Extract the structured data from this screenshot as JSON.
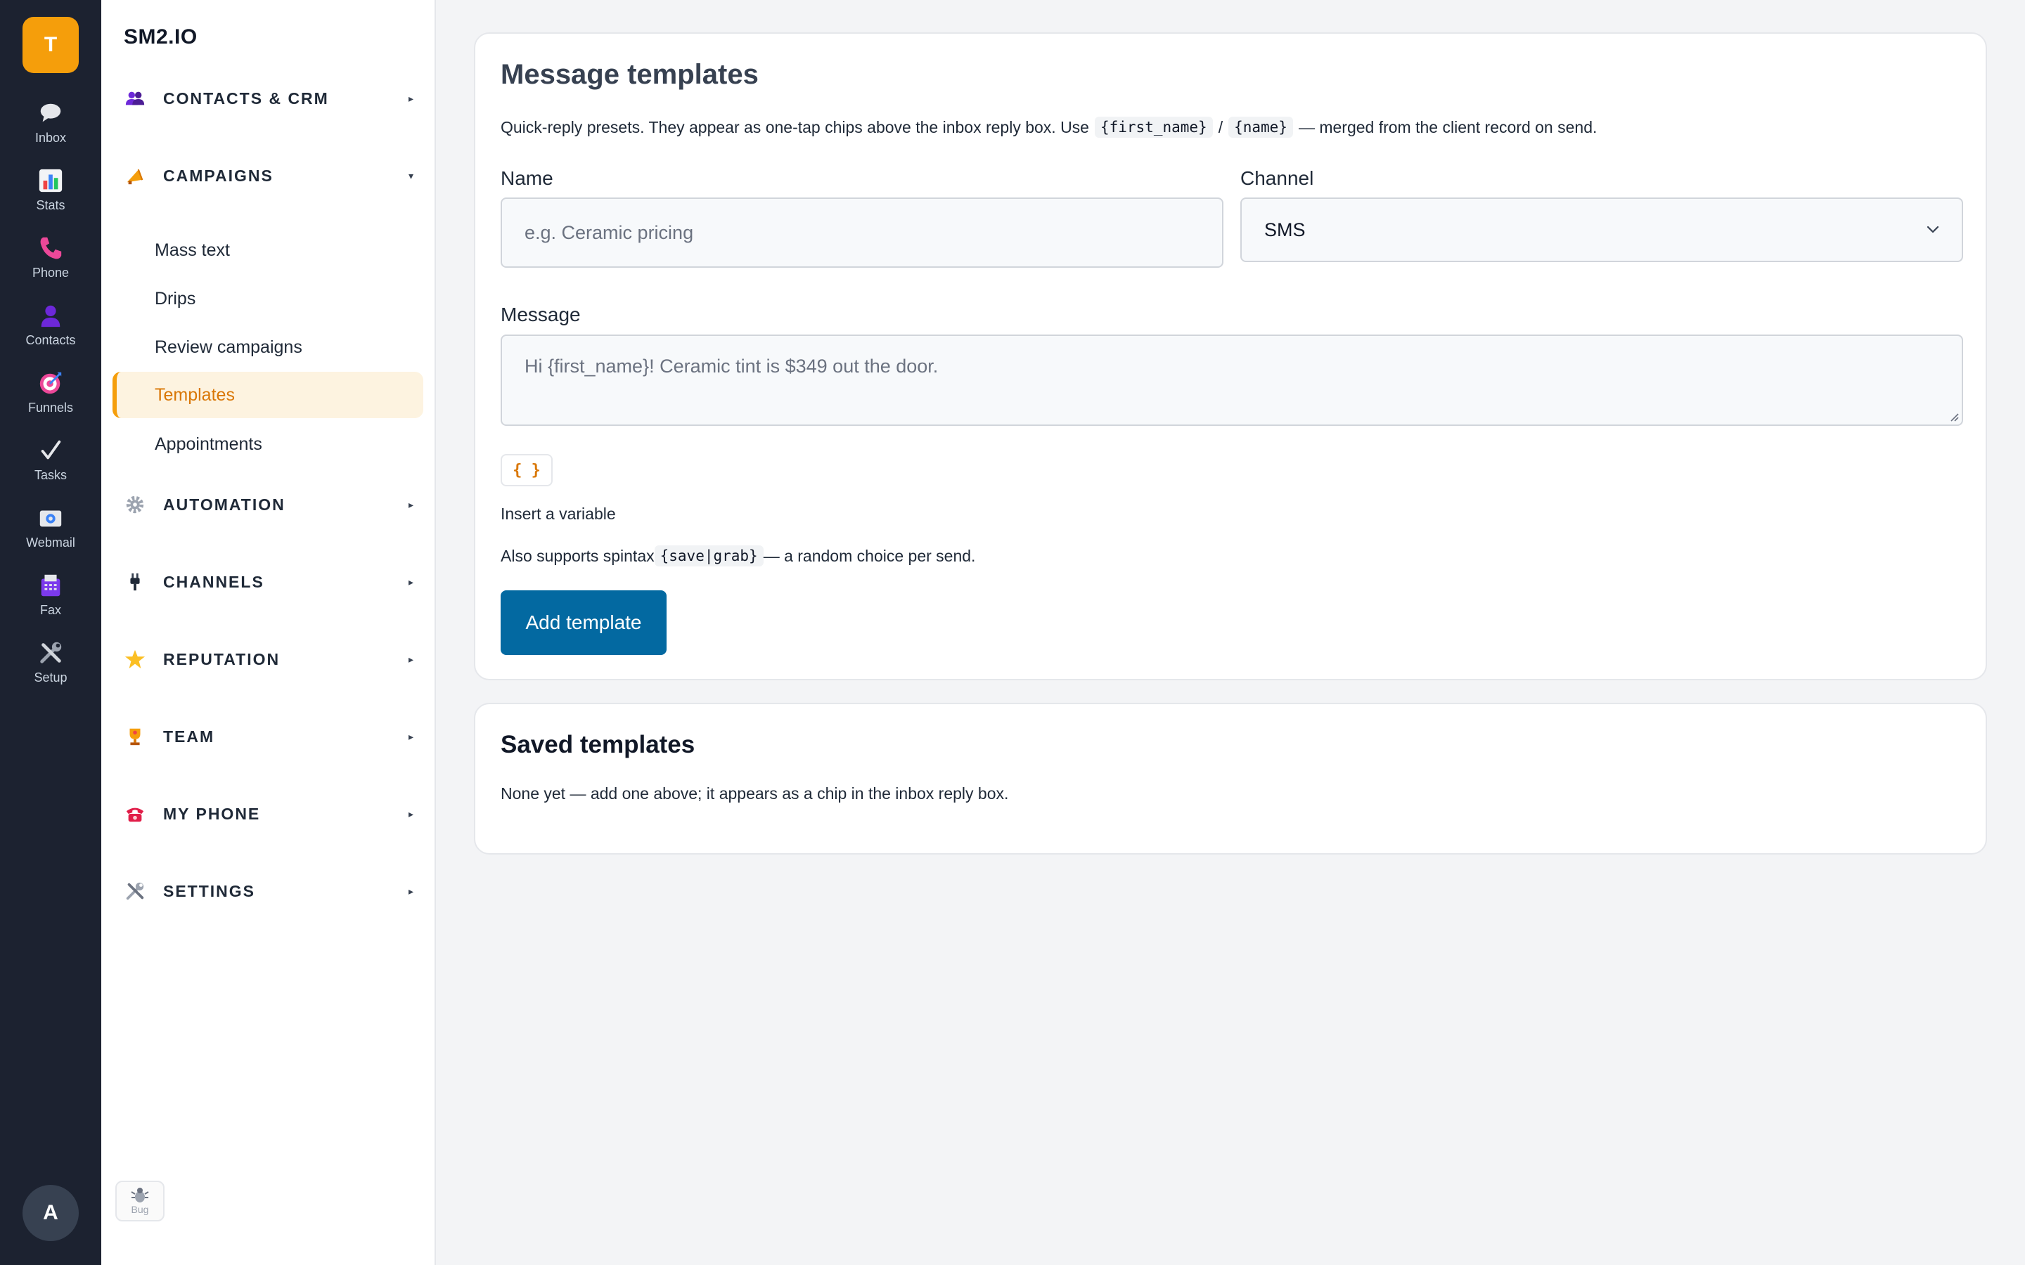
{
  "rail": {
    "logo_letter": "T",
    "items": [
      {
        "label": "Inbox",
        "icon": "chat-bubble-icon"
      },
      {
        "label": "Stats",
        "icon": "bar-chart-icon"
      },
      {
        "label": "Phone",
        "icon": "phone-icon"
      },
      {
        "label": "Contacts",
        "icon": "person-icon"
      },
      {
        "label": "Funnels",
        "icon": "target-icon"
      },
      {
        "label": "Tasks",
        "icon": "checkmark-icon"
      },
      {
        "label": "Webmail",
        "icon": "mail-icon"
      },
      {
        "label": "Fax",
        "icon": "fax-icon"
      },
      {
        "label": "Setup",
        "icon": "tools-icon"
      }
    ],
    "avatar_letter": "A"
  },
  "nav": {
    "brand": "SM2.IO",
    "sections": [
      {
        "label": "CONTACTS & CRM",
        "icon": "people-icon",
        "caret": "▸"
      },
      {
        "label": "CAMPAIGNS",
        "icon": "megaphone-icon",
        "caret": "▾"
      },
      {
        "label": "AUTOMATION",
        "icon": "gear-icon",
        "caret": "▸"
      },
      {
        "label": "CHANNELS",
        "icon": "plug-icon",
        "caret": "▸"
      },
      {
        "label": "REPUTATION",
        "icon": "star-icon",
        "caret": "▸"
      },
      {
        "label": "TEAM",
        "icon": "trophy-icon",
        "caret": "▸"
      },
      {
        "label": "MY PHONE",
        "icon": "telephone-icon",
        "caret": "▸"
      },
      {
        "label": "SETTINGS",
        "icon": "tools-icon",
        "caret": "▸"
      }
    ],
    "campaign_items": [
      {
        "label": "Mass text"
      },
      {
        "label": "Drips"
      },
      {
        "label": "Review campaigns"
      },
      {
        "label": "Templates",
        "active": true
      },
      {
        "label": "Appointments"
      }
    ],
    "bug_label": "Bug"
  },
  "form": {
    "title": "Message templates",
    "description_pre": "Quick-reply presets. They appear as one-tap chips above the inbox reply box. Use",
    "code_first_name": "{first_name}",
    "slash": "/",
    "code_name": "{name}",
    "description_post": "— merged from the client record on send.",
    "name_label": "Name",
    "name_placeholder": "e.g. Ceramic pricing",
    "channel_label": "Channel",
    "channel_value": "SMS",
    "message_label": "Message",
    "message_placeholder": "Hi {first_name}! Ceramic tint is $349 out the door.",
    "variable_button": "{ }",
    "insert_variable_text": "Insert a variable",
    "spintax_pre": "Also supports spintax",
    "spintax_code": "{save|grab}",
    "spintax_post": "— a random choice per send.",
    "submit_label": "Add template"
  },
  "saved": {
    "title": "Saved templates",
    "empty_text": "None yet — add one above; it appears as a chip in the inbox reply box."
  },
  "colors": {
    "rail_bg": "#1c2230",
    "accent": "#f59e0b",
    "primary": "#0369a1",
    "active_bg": "#fdf3e0"
  }
}
